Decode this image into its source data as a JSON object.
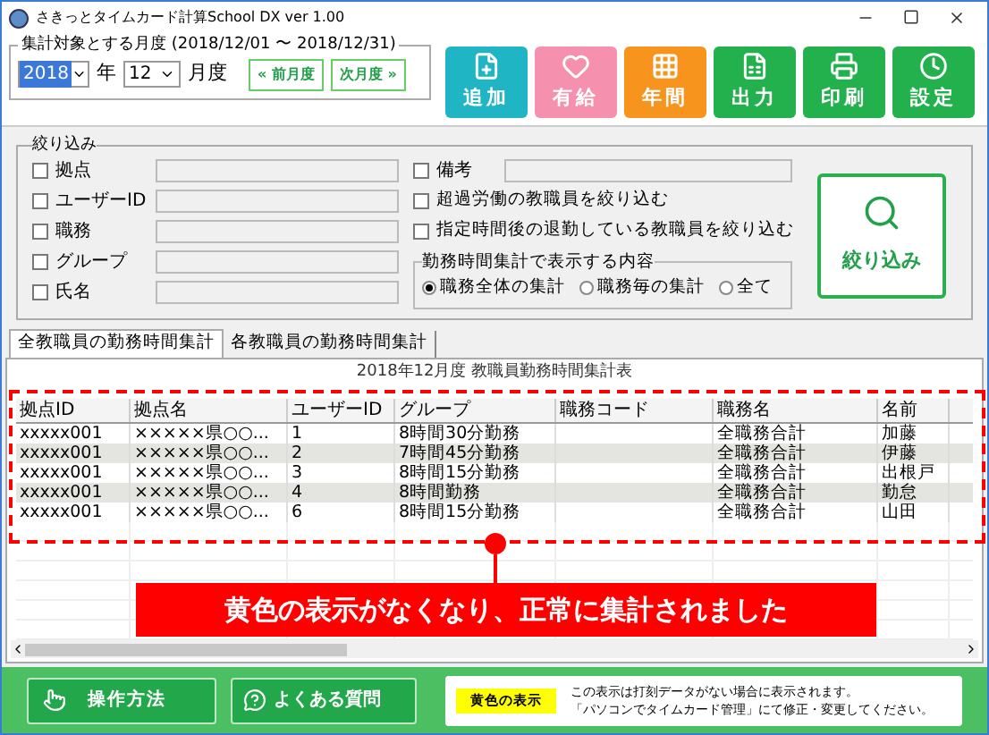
{
  "window": {
    "title": "さきっとタイムカード計算School DX  ver 1.00"
  },
  "period": {
    "title": "集計対象とする月度 (2018/12/01 〜 2018/12/31)",
    "year": "2018",
    "year_unit": "年",
    "month": "12",
    "month_unit": "月度",
    "prev": "« 前月度",
    "next": "次月度 »"
  },
  "toolbar": [
    {
      "label": "追加",
      "kind": "add",
      "color": "#1fb5c4"
    },
    {
      "label": "有給",
      "kind": "leave",
      "color": "#f590ae"
    },
    {
      "label": "年間",
      "kind": "annual",
      "color": "#f7941d"
    },
    {
      "label": "出力",
      "kind": "export",
      "color": "#22b14c"
    },
    {
      "label": "印刷",
      "kind": "print",
      "color": "#22b14c"
    },
    {
      "label": "設定",
      "kind": "settings",
      "color": "#22b14c"
    }
  ],
  "filter": {
    "title": "絞り込み",
    "fields": [
      {
        "label": "拠点",
        "checked": false
      },
      {
        "label": "ユーザーID",
        "checked": false
      },
      {
        "label": "職務",
        "checked": false
      },
      {
        "label": "グループ",
        "checked": false
      },
      {
        "label": "氏名",
        "checked": false
      }
    ],
    "note": {
      "label": "備考",
      "checked": false
    },
    "options": [
      {
        "label": "超過労働の教職員を絞り込む",
        "checked": false
      },
      {
        "label": "指定時間後の退勤している教職員を絞り込む",
        "checked": false
      }
    ],
    "summary": {
      "title": "勤務時間集計で表示する内容",
      "radios": [
        {
          "label": "職務全体の集計",
          "selected": true
        },
        {
          "label": "職務毎の集計",
          "selected": false
        },
        {
          "label": "全て",
          "selected": false
        }
      ]
    },
    "button": "絞り込み"
  },
  "tabs": [
    {
      "label": "全教職員の勤務時間集計",
      "selected": true
    },
    {
      "label": "各教職員の勤務時間集計",
      "selected": false
    }
  ],
  "table": {
    "title": "2018年12月度 教職員勤務時間集計表",
    "columns": [
      "拠点ID",
      "拠点名",
      "ユーザーID",
      "グループ",
      "職務コード",
      "職務名",
      "名前"
    ],
    "rows": [
      [
        "xxxxx001",
        "×××××県○○...",
        "1",
        "8時間30分勤務",
        "",
        "全職務合計",
        "加藤"
      ],
      [
        "xxxxx001",
        "×××××県○○...",
        "2",
        "7時間45分勤務",
        "",
        "全職務合計",
        "伊藤"
      ],
      [
        "xxxxx001",
        "×××××県○○...",
        "3",
        "8時間15分勤務",
        "",
        "全職務合計",
        "出根戸"
      ],
      [
        "xxxxx001",
        "×××××県○○...",
        "4",
        "8時間勤務",
        "",
        "全職務合計",
        "勤怠"
      ],
      [
        "xxxxx001",
        "×××××県○○...",
        "6",
        "8時間15分勤務",
        "",
        "全職務合計",
        "山田"
      ]
    ]
  },
  "callout": "黄色の表示がなくなり、正常に集計されました",
  "footer": {
    "buttons": [
      {
        "label": "操作方法",
        "kind": "manual"
      },
      {
        "label": "よくある質問",
        "kind": "faq"
      }
    ],
    "legend": {
      "swatch": "黄色の表示",
      "lines": [
        "この表示は打刻データがない場合に表示されます。",
        "「パソコンでタイムカード管理」にて修正・変更してください。"
      ]
    }
  }
}
